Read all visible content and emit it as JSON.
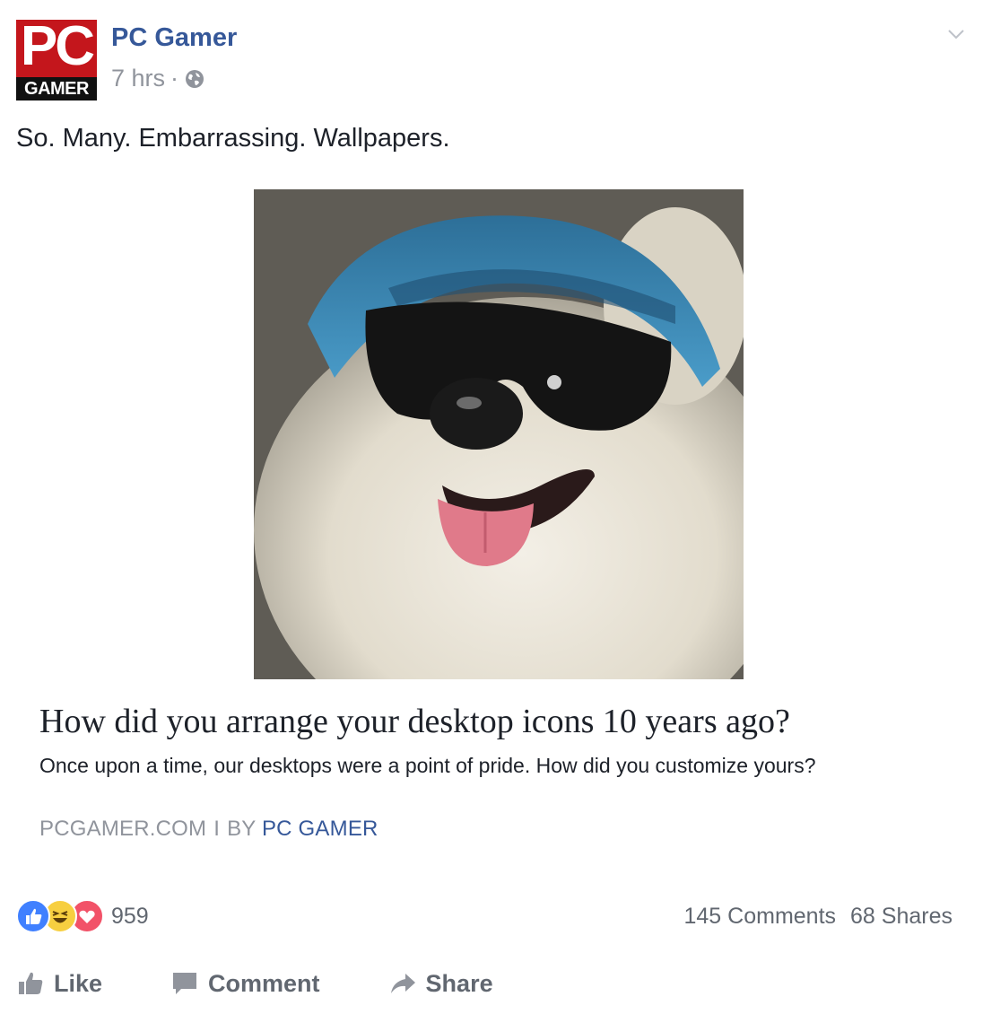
{
  "post": {
    "page_name": "PC Gamer",
    "logo_top": "PC",
    "logo_bottom": "GAMER",
    "timestamp": "7 hrs",
    "separator": "·",
    "status": "So. Many. Embarrassing. Wallpapers."
  },
  "link": {
    "title": "How did you arrange your desktop icons 10 years ago?",
    "description": "Once upon a time, our desktops were a point of pride. How did you customize yours?",
    "source": "PCGAMER.COM",
    "separator": "I",
    "by": "BY",
    "author": "PC GAMER"
  },
  "engagement": {
    "reactions": [
      "like-icon",
      "haha-icon",
      "love-icon"
    ],
    "reaction_count": "959",
    "comments": "145 Comments",
    "shares": "68 Shares"
  },
  "actions": {
    "like": "Like",
    "comment": "Comment",
    "share": "Share"
  },
  "colors": {
    "link_blue": "#365899",
    "meta_gray": "#90949c",
    "action_gray": "#616770",
    "brand_red": "#c4161c",
    "like_blue": "#4080ff",
    "haha_yellow": "#f7cf40",
    "love_red": "#f25268"
  }
}
